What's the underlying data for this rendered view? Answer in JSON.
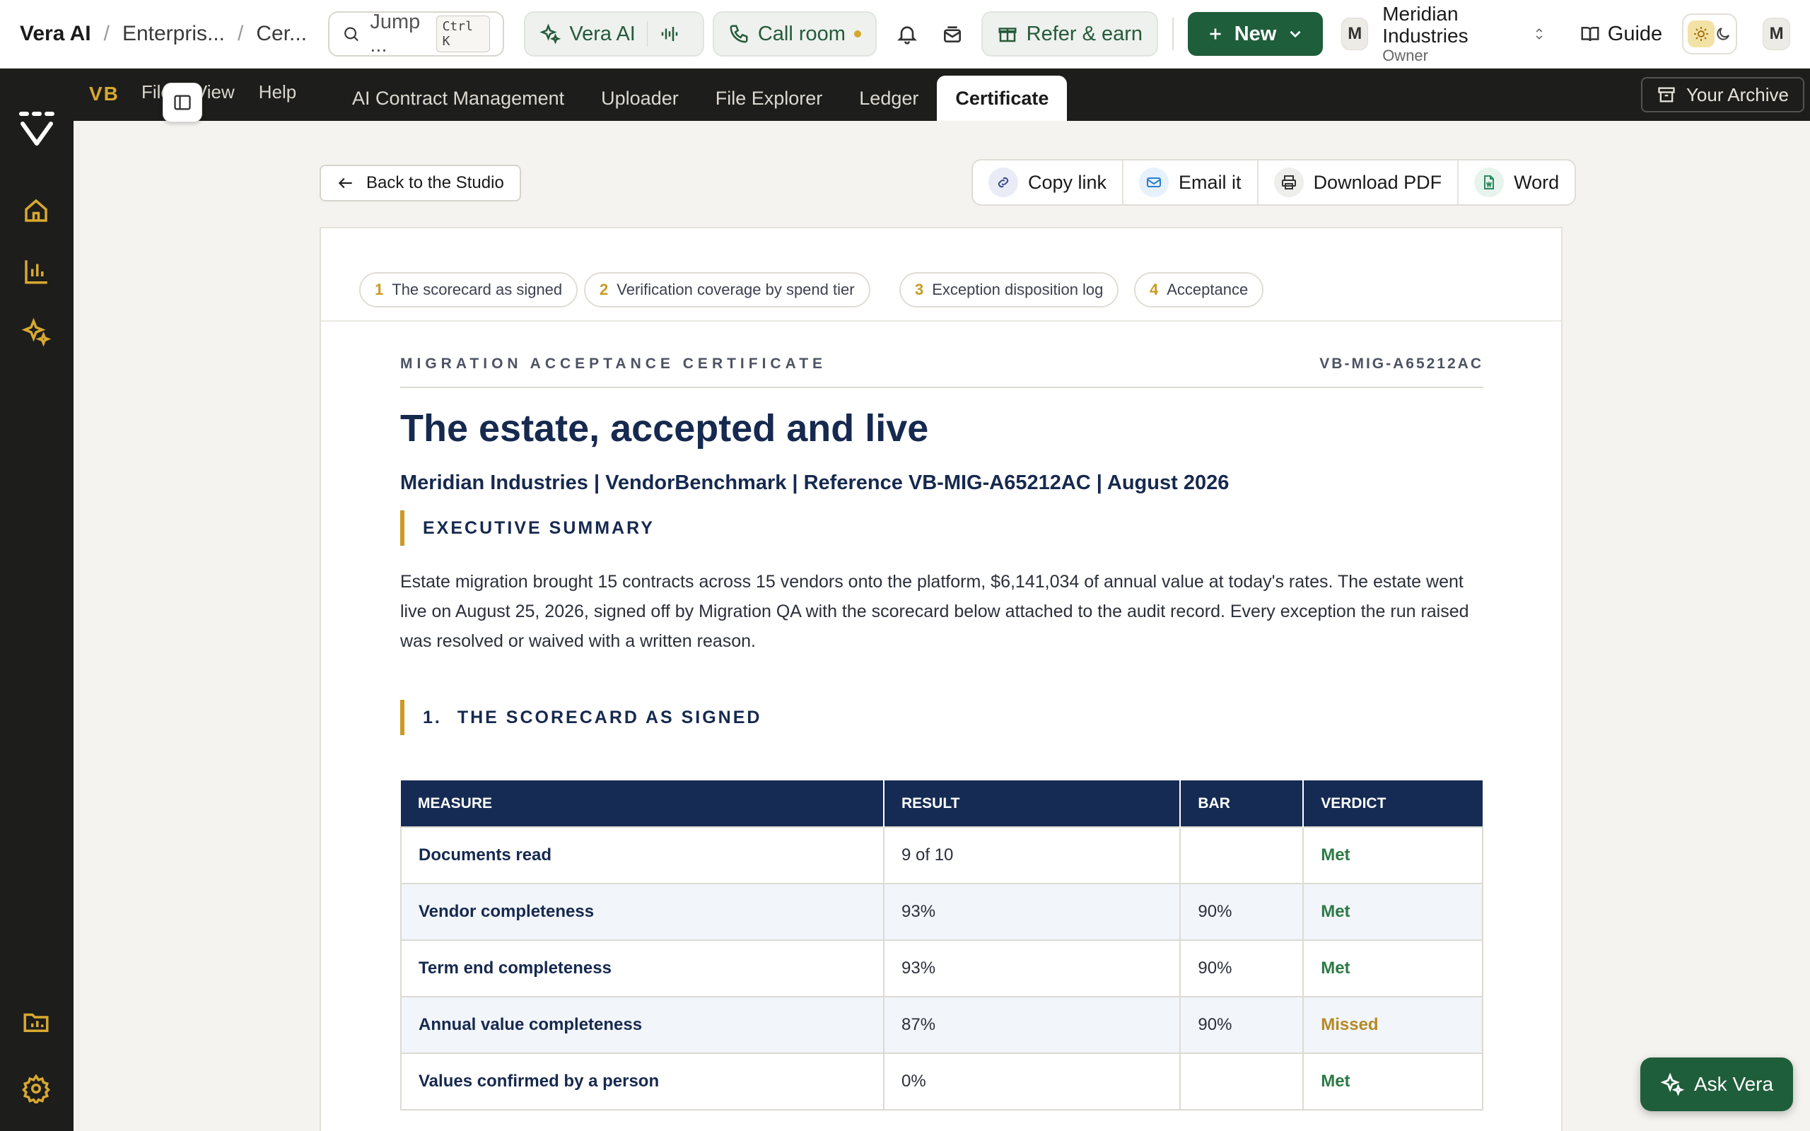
{
  "topbar": {
    "breadcrumb": [
      "Vera AI",
      "Enterpris...",
      "Cer..."
    ],
    "search": {
      "placeholder": "Jump ...",
      "shortcut": "Ctrl K"
    },
    "vera_label": "Vera AI",
    "call_label": "Call room",
    "refer_label": "Refer & earn",
    "new_label": "New",
    "account": {
      "initial": "M",
      "name": "Meridian Industries",
      "role": "Owner"
    },
    "guide_label": "Guide",
    "user_initial": "M"
  },
  "menubar": {
    "brand": "VB",
    "menu": [
      "File",
      "View",
      "Help"
    ],
    "tabs": [
      "AI Contract Management",
      "Uploader",
      "File Explorer",
      "Ledger",
      "Certificate"
    ],
    "active_tab": "Certificate",
    "archive_label": "Your Archive"
  },
  "toolbar": {
    "back_label": "Back to the Studio",
    "actions": [
      "Copy link",
      "Email it",
      "Download PDF",
      "Word"
    ]
  },
  "chips": [
    {
      "num": "1",
      "label": "The scorecard as signed"
    },
    {
      "num": "2",
      "label": "Verification coverage by spend tier"
    },
    {
      "num": "3",
      "label": "Exception disposition log"
    },
    {
      "num": "4",
      "label": "Acceptance"
    }
  ],
  "document": {
    "eyebrow": "MIGRATION ACCEPTANCE CERTIFICATE",
    "reference": "VB-MIG-A65212AC",
    "title": "The estate, accepted and live",
    "subtitle": "Meridian Industries | VendorBenchmark | Reference VB-MIG-A65212AC | August 2026",
    "exec_heading": "EXECUTIVE SUMMARY",
    "exec_summary": "Estate migration brought 15 contracts across 15 vendors onto the platform, $6,141,034 of annual value at today's rates. The estate went live on August 25, 2026, signed off by Migration QA with the scorecard below attached to the audit record. Every exception the run raised was resolved or waived with a written reason.",
    "section1_num": "1.",
    "section1_heading": "THE SCORECARD AS SIGNED",
    "table": {
      "headers": [
        "MEASURE",
        "RESULT",
        "BAR",
        "VERDICT"
      ],
      "rows": [
        {
          "measure": "Documents read",
          "result": "9 of 10",
          "bar": "",
          "verdict": "Met"
        },
        {
          "measure": "Vendor completeness",
          "result": "93%",
          "bar": "90%",
          "verdict": "Met"
        },
        {
          "measure": "Term end completeness",
          "result": "93%",
          "bar": "90%",
          "verdict": "Met"
        },
        {
          "measure": "Annual value completeness",
          "result": "87%",
          "bar": "90%",
          "verdict": "Missed"
        },
        {
          "measure": "Values confirmed by a person",
          "result": "0%",
          "bar": "",
          "verdict": "Met"
        }
      ]
    }
  },
  "ask_label": "Ask Vera",
  "colors": {
    "brand_green": "#1f5e3b",
    "navy": "#16294f",
    "gold": "#c99a24",
    "met": "#2d7a46",
    "missed": "#b48a24"
  }
}
